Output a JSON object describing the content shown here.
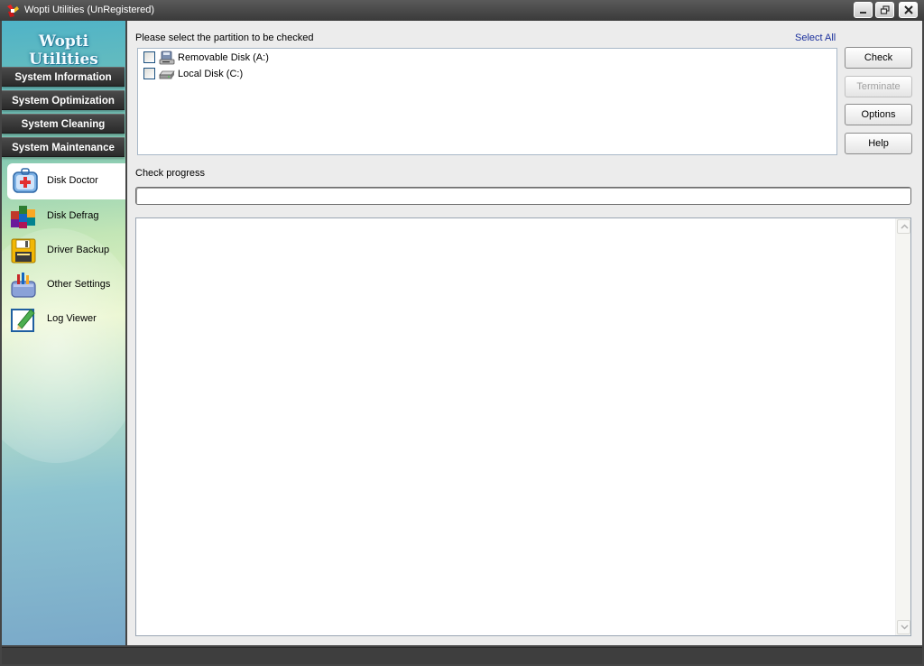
{
  "window": {
    "title": "Wopti Utilities (UnRegistered)"
  },
  "sidebar": {
    "brand": "Wopti Utilities",
    "categories": [
      {
        "label": "System Information"
      },
      {
        "label": "System Optimization"
      },
      {
        "label": "System Cleaning"
      },
      {
        "label": "System Maintenance"
      }
    ],
    "tools": [
      {
        "label": "Disk Doctor",
        "icon": "first-aid-kit-icon",
        "selected": true
      },
      {
        "label": "Disk Defrag",
        "icon": "defrag-blocks-icon"
      },
      {
        "label": "Driver Backup",
        "icon": "floppy-disk-icon"
      },
      {
        "label": "Other Settings",
        "icon": "toolbox-icon"
      },
      {
        "label": "Log Viewer",
        "icon": "notepad-pencil-icon"
      }
    ]
  },
  "main": {
    "partition_prompt": "Please select the partition to be checked",
    "select_all": "Select All",
    "partitions": [
      {
        "label": "Removable Disk (A:)",
        "icon": "floppy-drive-icon",
        "checked": false
      },
      {
        "label": "Local Disk (C:)",
        "icon": "hard-drive-icon",
        "checked": false
      }
    ],
    "buttons": {
      "check": "Check",
      "terminate": "Terminate",
      "options": "Options",
      "help": "Help"
    },
    "progress_label": "Check progress",
    "progress_value": 0,
    "log_text": ""
  },
  "colors": {
    "link": "#1a2f9c",
    "chrome_dark": "#3e3e3e",
    "panel_bg": "#ececec"
  }
}
